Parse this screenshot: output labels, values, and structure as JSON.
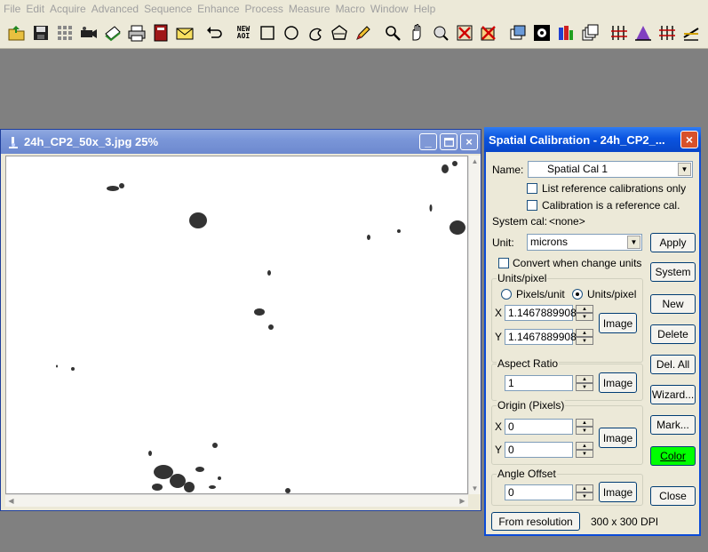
{
  "menu": [
    "File",
    "Edit",
    "Acquire",
    "Advanced",
    "Sequence",
    "Enhance",
    "Process",
    "Measure",
    "Macro",
    "Window",
    "Help"
  ],
  "toolbar": {
    "new_aoi_line1": "NEW",
    "new_aoi_line2": "AOI"
  },
  "image_window": {
    "title": "24h_CP2_50x_3.jpg 25%"
  },
  "dialog": {
    "title": "Spatial Calibration - 24h_CP2_...",
    "name_label": "Name:",
    "name_value": "Spatial Cal 1",
    "list_ref_only": "List reference calibrations only",
    "is_ref_cal": "Calibration is a reference cal.",
    "system_cal_label": "System cal:",
    "system_cal_value": "<none>",
    "unit_label": "Unit:",
    "unit_value": "microns",
    "convert_units": "Convert when change units",
    "units_pixel_group": "Units/pixel",
    "pixels_unit": "Pixels/unit",
    "units_pixel": "Units/pixel",
    "x_label": "X",
    "y_label": "Y",
    "x_value": "1.1467889908",
    "y_value": "1.1467889908",
    "image_btn": "Image",
    "aspect_group": "Aspect Ratio",
    "aspect_value": "1",
    "origin_group": "Origin (Pixels)",
    "origin_x": "0",
    "origin_y": "0",
    "angle_group": "Angle Offset",
    "angle_value": "0",
    "from_resolution": "From resolution",
    "dpi": "300 x 300 DPI",
    "buttons": {
      "apply": "Apply",
      "system": "System",
      "new": "New",
      "delete": "Delete",
      "del_all": "Del. All",
      "wizard": "Wizard...",
      "mark": "Mark...",
      "color": "Color",
      "close": "Close"
    },
    "color_accent": "#00ff00"
  }
}
